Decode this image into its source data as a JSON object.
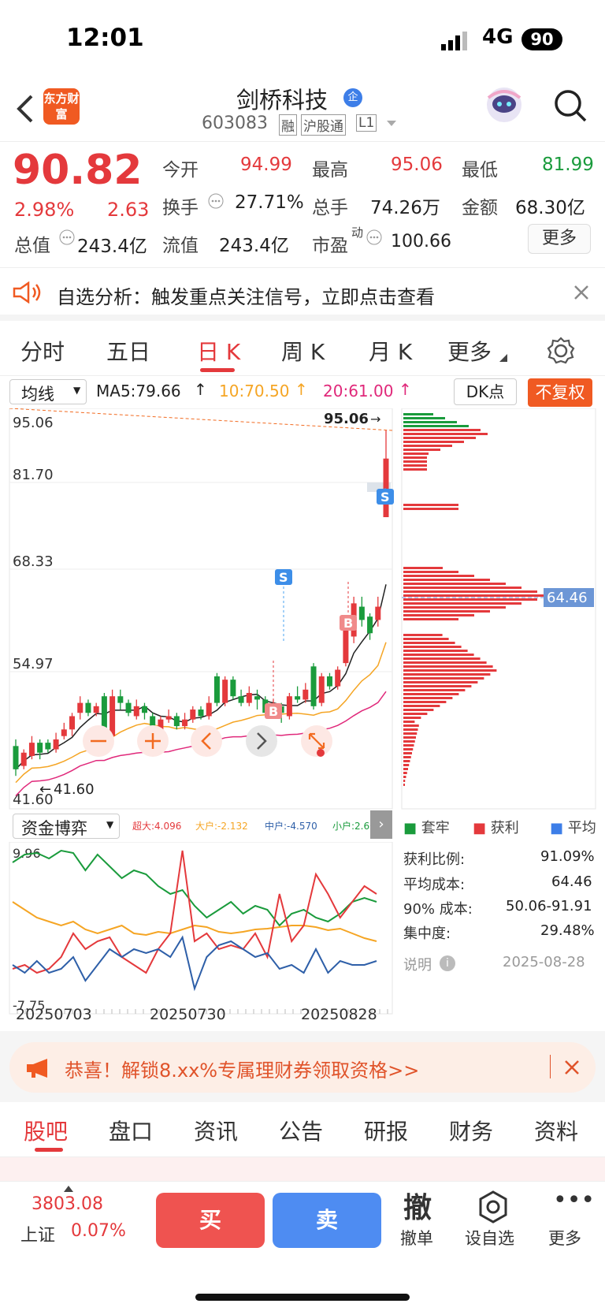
{
  "status": {
    "time": "12:01",
    "network": "4G",
    "battery": "90"
  },
  "header": {
    "logo": "东方财富",
    "name": "剑桥科技",
    "badge": "企",
    "code": "603083",
    "tags": [
      "融",
      "沪股通",
      "L1"
    ]
  },
  "quote": {
    "price": "90.82",
    "pct": "2.98%",
    "chg": "2.63",
    "open_l": "今开",
    "open": "94.99",
    "high_l": "最高",
    "high": "95.06",
    "low_l": "最低",
    "low": "81.99",
    "turn_l": "换手",
    "turn": "27.71%",
    "vol_l": "总手",
    "vol": "74.26万",
    "amt_l": "金额",
    "amt": "68.30亿",
    "mcap_l": "总值",
    "mcap": "243.4亿",
    "float_l": "流值",
    "float": "243.4亿",
    "pe_l": "市盈",
    "pe_sup": "动",
    "pe": "100.66",
    "more": "更多"
  },
  "notice": {
    "text": "自选分析：触发重点关注信号，立即点击查看"
  },
  "tabs": [
    "分时",
    "五日",
    "日 K",
    "周 K",
    "月 K",
    "更多"
  ],
  "ma": {
    "select": "均线",
    "ma5": "MA5:79.66",
    "ma10": "10:70.50",
    "ma20": "20:61.00",
    "dk": "DK点",
    "fq": "不复权"
  },
  "kaxis": [
    "95.06",
    "81.70",
    "68.33",
    "54.97",
    "41.60"
  ],
  "kmark": {
    "high": "95.06",
    "low": "41.60",
    "avg": "64.46"
  },
  "fund": {
    "select": "资金博弈",
    "l1": "超大:4.096",
    "l2": "大户:-2.132",
    "l3": "中户:-4.570",
    "l4": "小户:2.606",
    "top": "9.96",
    "bot": "-7.75"
  },
  "dates": [
    "20250703",
    "20250730",
    "20250828"
  ],
  "chip": {
    "legend": [
      "套牢",
      "获利",
      "平均"
    ],
    "rows": [
      [
        "获利比例:",
        "91.09%"
      ],
      [
        "平均成本:",
        "64.46"
      ],
      [
        "90% 成本:",
        "50.06-91.91"
      ],
      [
        "集中度:",
        "29.48%"
      ]
    ],
    "note": "说明",
    "date": "2025-08-28"
  },
  "promo": {
    "text": "恭喜！解锁8.xx%专属理财券领取资格>>"
  },
  "subtabs": [
    "股吧",
    "盘口",
    "资讯",
    "公告",
    "研报",
    "财务",
    "资料"
  ],
  "bottom": {
    "index": "3803.08",
    "index_name": "上证",
    "index_pct": "0.07%",
    "buy": "买",
    "sell": "卖",
    "cancel_icon": "撤",
    "cancel": "撤单",
    "fav": "设自选",
    "more": "更多"
  },
  "chart_data": {
    "type": "candlestick",
    "ylim": [
      41.6,
      95.06
    ],
    "x_range": [
      "20250703",
      "20250828"
    ],
    "candles": [
      [
        47.5,
        44,
        48.5,
        43
      ],
      [
        44.5,
        46.5,
        47,
        44
      ],
      [
        46,
        48,
        49,
        45.5
      ],
      [
        48,
        46.5,
        48.5,
        45.5
      ],
      [
        48,
        47,
        48.5,
        46.5
      ],
      [
        47,
        48.5,
        49.5,
        46.5
      ],
      [
        49,
        50,
        51,
        48.5
      ],
      [
        50,
        52,
        52.5,
        49
      ],
      [
        52.5,
        54,
        55,
        51.5
      ],
      [
        54,
        52.5,
        54.5,
        52
      ],
      [
        52.5,
        53.5,
        54,
        52
      ],
      [
        55,
        49.5,
        55.5,
        49
      ],
      [
        49,
        55,
        56,
        48.5
      ],
      [
        55,
        54,
        56,
        53
      ],
      [
        54,
        52.5,
        54.5,
        52
      ],
      [
        52,
        53.5,
        54.5,
        51.5
      ],
      [
        53.5,
        52.5,
        54,
        51.5
      ],
      [
        52,
        50,
        52.5,
        49
      ],
      [
        50,
        51.5,
        52,
        49.5
      ],
      [
        51.5,
        52,
        53,
        51
      ],
      [
        52,
        50.5,
        52.5,
        50
      ],
      [
        50.5,
        51.5,
        52.5,
        50
      ],
      [
        51.5,
        53,
        53.5,
        51
      ],
      [
        53,
        52,
        53.5,
        51.5
      ],
      [
        52,
        54,
        55,
        51.5
      ],
      [
        58,
        54,
        58.5,
        53.5
      ],
      [
        54,
        57.5,
        58,
        53.5
      ],
      [
        57.5,
        55,
        58,
        54.5
      ],
      [
        55,
        54,
        56,
        53.5
      ],
      [
        54,
        55.5,
        56.5,
        53.5
      ],
      [
        55,
        54.5,
        56,
        53
      ],
      [
        54.5,
        52.5,
        55,
        52
      ],
      [
        52.5,
        53.5,
        54.5,
        52
      ],
      [
        53.5,
        52.5,
        54,
        51
      ],
      [
        52,
        55,
        55.5,
        51.5
      ],
      [
        55,
        54.5,
        56.5,
        54
      ],
      [
        54.5,
        56,
        57,
        54
      ],
      [
        59.5,
        53.5,
        60,
        53
      ],
      [
        54,
        58,
        58.5,
        53.5
      ],
      [
        58,
        56.5,
        58.5,
        56
      ],
      [
        56.5,
        59,
        59.5,
        56
      ],
      [
        60,
        65,
        65.5,
        59.5
      ],
      [
        64,
        69,
        70,
        63
      ],
      [
        68.5,
        66.5,
        70,
        65.5
      ],
      [
        67,
        64.5,
        67.5,
        63.5
      ],
      [
        66.5,
        68.5,
        70,
        65.5
      ],
      [
        81.99,
        90.82,
        95.06,
        81.99
      ]
    ]
  }
}
